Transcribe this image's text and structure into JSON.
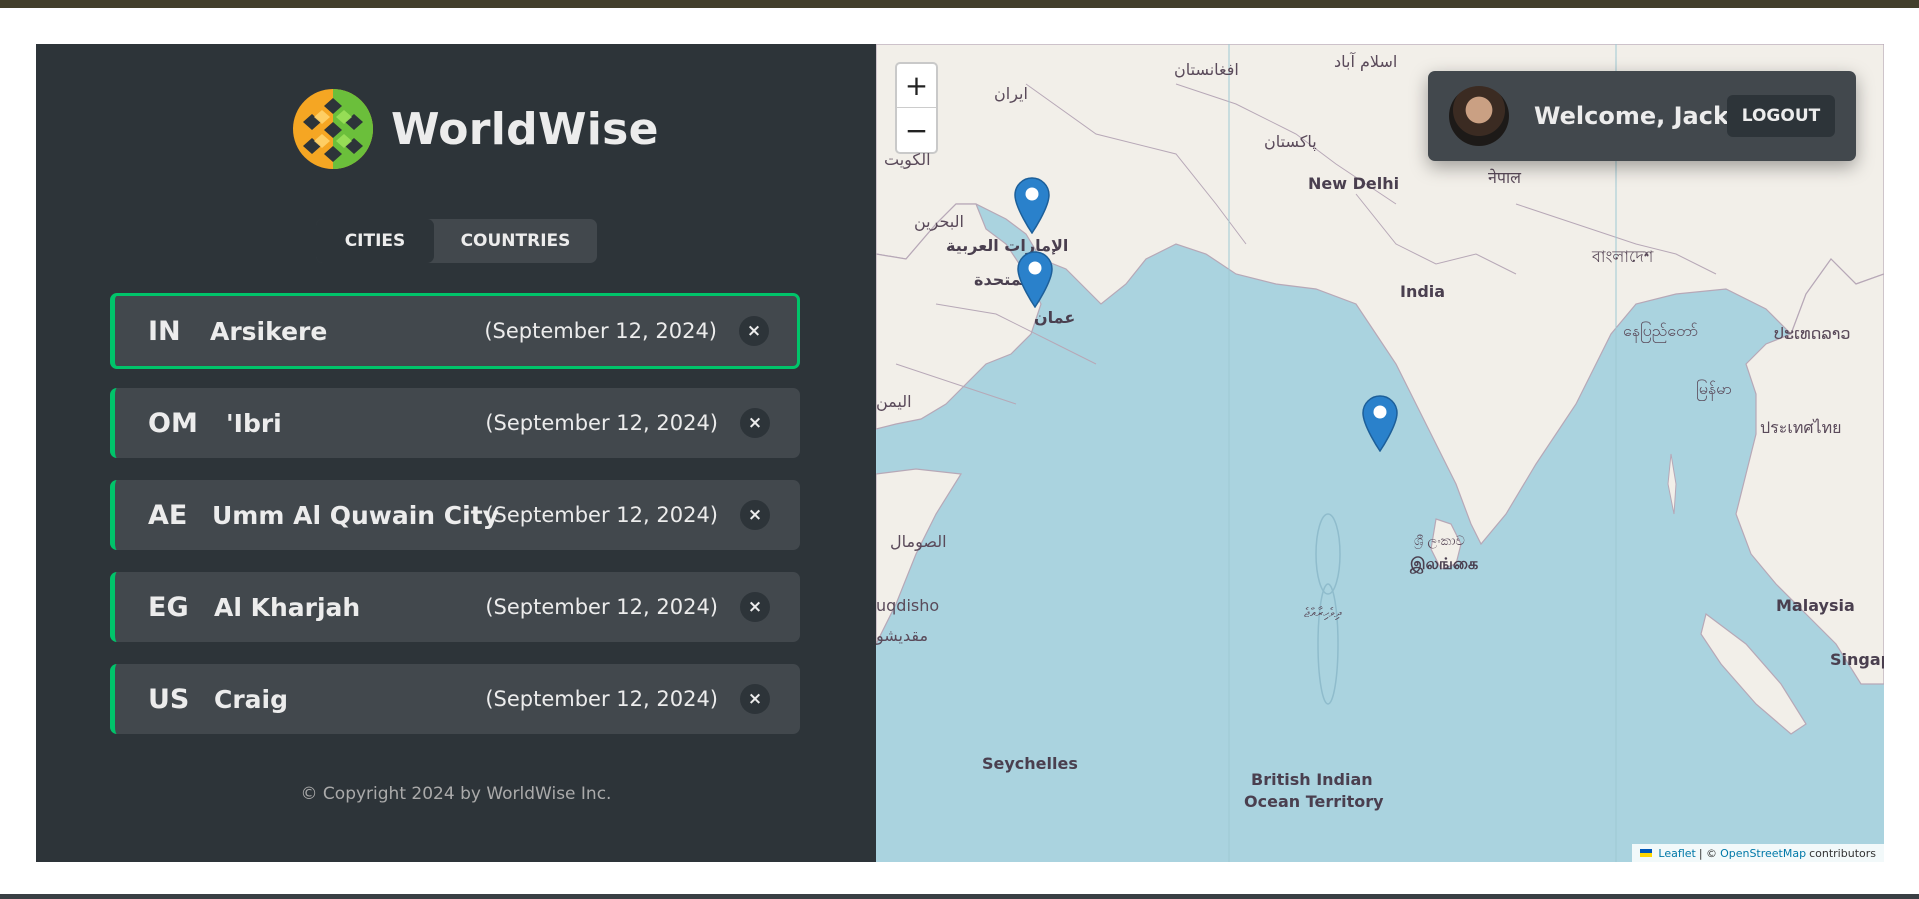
{
  "app": {
    "name": "WorldWise"
  },
  "tabs": [
    {
      "label": "CITIES",
      "active": true
    },
    {
      "label": "COUNTRIES",
      "active": false
    }
  ],
  "cities": [
    {
      "flag": "IN",
      "name": "Arsikere",
      "date": "(September 12, 2024)",
      "active": true
    },
    {
      "flag": "OM",
      "name": "'Ibri",
      "date": "(September 12, 2024)",
      "active": false
    },
    {
      "flag": "AE",
      "name": "Umm Al Quwain City",
      "date": "(September 12, 2024)",
      "active": false
    },
    {
      "flag": "EG",
      "name": "Al Kharjah",
      "date": "(September 12, 2024)",
      "active": false
    },
    {
      "flag": "US",
      "name": "Craig",
      "date": "(September 12, 2024)",
      "active": false
    }
  ],
  "delete_symbol": "×",
  "footer": {
    "copyright": "© Copyright 2024 by WorldWise Inc."
  },
  "user": {
    "welcome": "Welcome, Jack",
    "logout_label": "LOGOUT"
  },
  "map": {
    "zoom_in": "+",
    "zoom_out": "−",
    "labels": {
      "iran": "ایران",
      "afghanistan": "افغانستان",
      "islamabad": "اسلام آباد",
      "pakistan": "پاکستان",
      "new_delhi": "New Delhi",
      "nepal": "नेपाल",
      "kuwait": "الكويت",
      "bahrain": "البحرين",
      "uae_1": "الإمارات العربية",
      "uae_2": "المتحدة",
      "oman": "عمان",
      "india": "India",
      "bangladesh": "বাংলাদেশ",
      "myanmar": "မြန်မာ",
      "myanmar_2": "နေပြည်တော်",
      "laos": "ປະເທດລາວ",
      "thailand": "ประเทศไทย",
      "yemen": "اليمن",
      "somalia": "الصومال",
      "mogadishu": "uqdisho",
      "mogadishu_ar": "مقديشو",
      "sri_lanka_1": "ශ්‍රී ලංකාව",
      "sri_lanka_2": "இலங்கை",
      "maldives": "ދިވެހިރާއްޖެ",
      "malaysia": "Malaysia",
      "singapore": "Singapore",
      "seychelles": "Seychelles",
      "biot_1": "British Indian",
      "biot_2": "Ocean Territory"
    },
    "attribution": {
      "leaflet": "Leaflet",
      "separator": "| ©",
      "osm": "OpenStreetMap",
      "suffix": "contributors"
    }
  },
  "colors": {
    "sidebar_bg": "#2d3439",
    "item_bg": "#42484d",
    "accent_green": "#00c46a",
    "water": "#aad3df",
    "land": "#f2efe9",
    "marker_blue": "#2a81cb"
  }
}
